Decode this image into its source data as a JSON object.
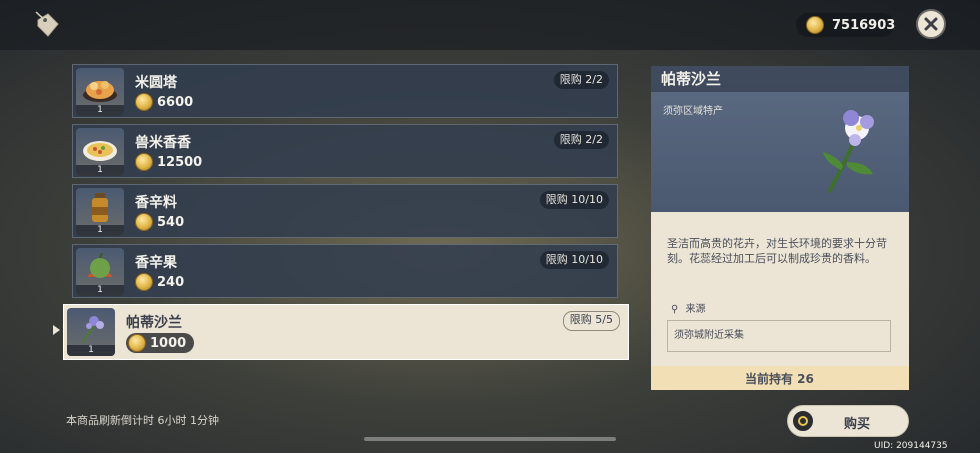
{
  "header": {
    "currency_value": "7516903",
    "shop_icon": "shop-tag-icon",
    "close_icon": "close-icon"
  },
  "items": [
    {
      "name": "米圆塔",
      "price": "6600",
      "limit": "限购 2/2",
      "qty": "1",
      "icon": "rice-pudding-icon"
    },
    {
      "name": "兽米香香",
      "price": "12500",
      "limit": "限购 2/2",
      "qty": "1",
      "icon": "pizza-dish-icon"
    },
    {
      "name": "香辛料",
      "price": "540",
      "limit": "限购 10/10",
      "qty": "1",
      "icon": "spice-jar-icon"
    },
    {
      "name": "香辛果",
      "price": "240",
      "limit": "限购 10/10",
      "qty": "1",
      "icon": "spice-fruit-icon"
    },
    {
      "name": "帕蒂沙兰",
      "price": "1000",
      "limit": "限购 5/5",
      "qty": "1",
      "icon": "padisarah-flower-icon"
    }
  ],
  "refresh_text": "本商品刷新倒计时 6小时 1分钟",
  "detail": {
    "title": "帕蒂沙兰",
    "type": "须弥区域特产",
    "description": "圣洁而高贵的花卉，对生长环境的要求十分苛刻。花蕊经过加工后可以制成珍贵的香料。",
    "source_label": "来源",
    "source_value": "须弥城附近采集",
    "owned": "当前持有 26"
  },
  "buy_label": "购买",
  "uid": "UID: 209144735",
  "colors": {
    "panel_bg": "#ece5d5",
    "owned_bar": "#f2dfb5",
    "coin": "#e0b548"
  }
}
